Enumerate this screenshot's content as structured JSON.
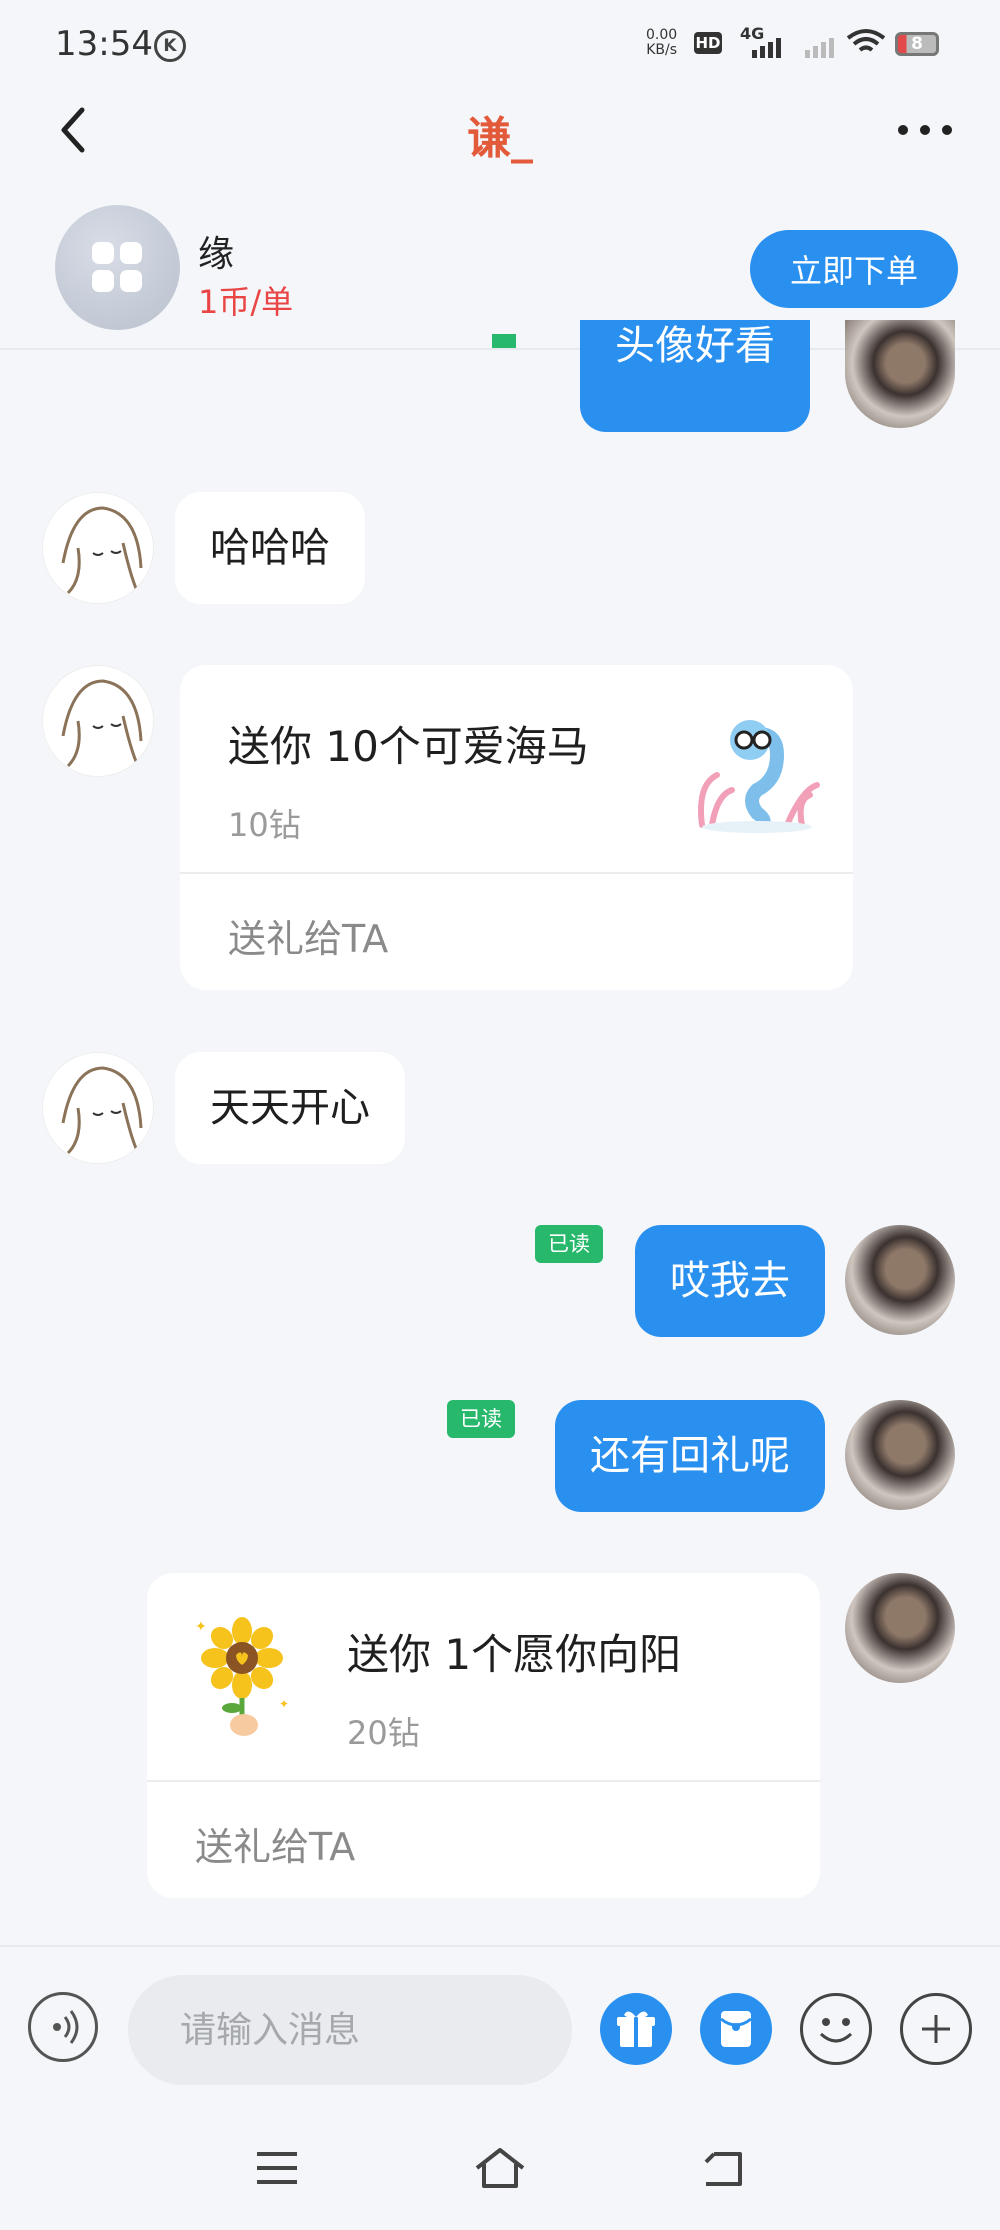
{
  "status_bar": {
    "time": "13:54",
    "k_badge": "K",
    "net_speed_value": "0.00",
    "net_speed_unit": "KB/s",
    "hd_label": "HD",
    "network_label": "4G",
    "battery_level": "8"
  },
  "header": {
    "title": "谦_",
    "back_icon": "chevron-left-icon",
    "more_icon": "more-horizontal-icon"
  },
  "service": {
    "name": "缘",
    "price": "1币/单",
    "order_button": "立即下单"
  },
  "messages": {
    "m0": {
      "direction": "outgoing",
      "text": "头像好看"
    },
    "m1": {
      "direction": "incoming",
      "text": "哈哈哈"
    },
    "gift1": {
      "direction": "incoming",
      "title": "送你 10个可爱海马",
      "price": "10钻",
      "action": "送礼给TA",
      "icon": "seahorse-gift-icon"
    },
    "m2": {
      "direction": "incoming",
      "text": "天天开心"
    },
    "m3": {
      "direction": "outgoing",
      "text": "哎我去",
      "read_label": "已读"
    },
    "m4": {
      "direction": "outgoing",
      "text": "还有回礼呢",
      "read_label": "已读"
    },
    "gift2": {
      "direction": "outgoing",
      "title": "送你 1个愿你向阳",
      "price": "20钻",
      "action": "送礼给TA",
      "icon": "sunflower-gift-icon"
    }
  },
  "input_bar": {
    "placeholder": "请输入消息",
    "icons": [
      "voice-icon",
      "gift-icon",
      "red-packet-icon",
      "emoji-icon",
      "plus-icon"
    ]
  },
  "nav_bar": {
    "icons": [
      "menu-icon",
      "home-icon",
      "back-icon"
    ]
  },
  "colors": {
    "accent": "#2a90f0",
    "title": "#e35a3b",
    "price": "#ea4545",
    "read_badge": "#27b86c"
  }
}
